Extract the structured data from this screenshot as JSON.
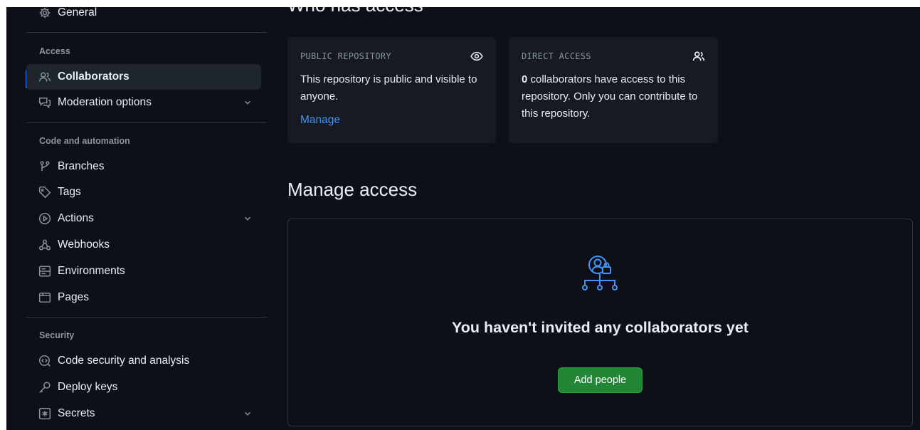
{
  "sidebar": {
    "general": "General",
    "sections": {
      "access": "Access",
      "code_automation": "Code and automation",
      "security": "Security"
    },
    "items": {
      "collaborators": "Collaborators",
      "moderation": "Moderation options",
      "branches": "Branches",
      "tags": "Tags",
      "actions": "Actions",
      "webhooks": "Webhooks",
      "environments": "Environments",
      "pages": "Pages",
      "code_security": "Code security and analysis",
      "deploy_keys": "Deploy keys",
      "secrets": "Secrets"
    }
  },
  "main": {
    "who_heading": "Who has access",
    "public_card": {
      "title": "PUBLIC REPOSITORY",
      "text": "This repository is public and visible to anyone.",
      "link": "Manage"
    },
    "direct_card": {
      "title": "DIRECT ACCESS",
      "count": "0",
      "text": " collaborators have access to this repository. Only you can contribute to this repository."
    },
    "manage_heading": "Manage access",
    "empty_title": "You haven't invited any collaborators yet",
    "add_button": "Add people"
  },
  "colors": {
    "background": "#0d1117",
    "card": "#161b22",
    "border": "#30363d",
    "accent": "#2f81f7",
    "link": "#4493f8",
    "button": "#238636",
    "muted": "#8b949e"
  }
}
